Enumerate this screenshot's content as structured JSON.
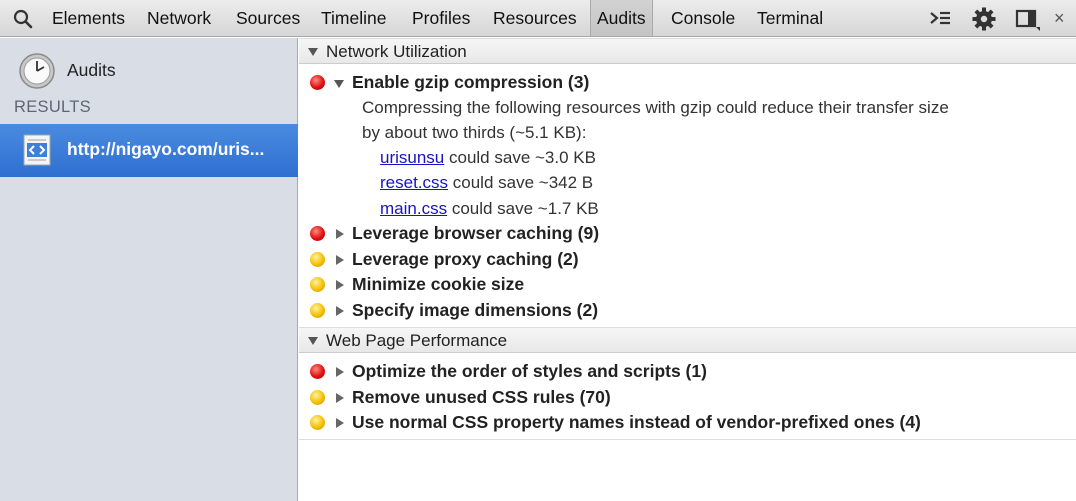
{
  "toolbar": {
    "tabs": [
      "Elements",
      "Network",
      "Sources",
      "Timeline",
      "Profiles",
      "Resources",
      "Audits",
      "Console",
      "Terminal"
    ],
    "active_tab": "Audits",
    "close_label": "×"
  },
  "sidebar": {
    "audits_label": "Audits",
    "results_label": "RESULTS",
    "result_item": "http://nigayo.com/uris..."
  },
  "sections": [
    {
      "title": "Network Utilization",
      "rules": [
        {
          "severity": "red",
          "expanded": true,
          "title": "Enable gzip compression (3)",
          "description": [
            "Compressing the following resources with gzip could reduce their transfer size",
            "by about two thirds (~5.1 KB):"
          ],
          "resources": [
            {
              "link": "urisunsu",
              "text": "could save ~3.0 KB"
            },
            {
              "link": "reset.css",
              "text": "could save ~342 B"
            },
            {
              "link": "main.css",
              "text": "could save ~1.7 KB"
            }
          ]
        },
        {
          "severity": "red",
          "expanded": false,
          "title": "Leverage browser caching (9)"
        },
        {
          "severity": "yellow",
          "expanded": false,
          "title": "Leverage proxy caching (2)"
        },
        {
          "severity": "yellow",
          "expanded": false,
          "title": "Minimize cookie size"
        },
        {
          "severity": "yellow",
          "expanded": false,
          "title": "Specify image dimensions (2)"
        }
      ]
    },
    {
      "title": "Web Page Performance",
      "rules": [
        {
          "severity": "red",
          "expanded": false,
          "title": "Optimize the order of styles and scripts (1)"
        },
        {
          "severity": "yellow",
          "expanded": false,
          "title": "Remove unused CSS rules (70)"
        },
        {
          "severity": "yellow",
          "expanded": false,
          "title": "Use normal CSS property names instead of vendor-prefixed ones (4)"
        }
      ]
    }
  ],
  "colors": {
    "red": "#e01010",
    "yellow": "#f5c000",
    "selection": "#3a7bd8",
    "link": "#1a12c8"
  }
}
